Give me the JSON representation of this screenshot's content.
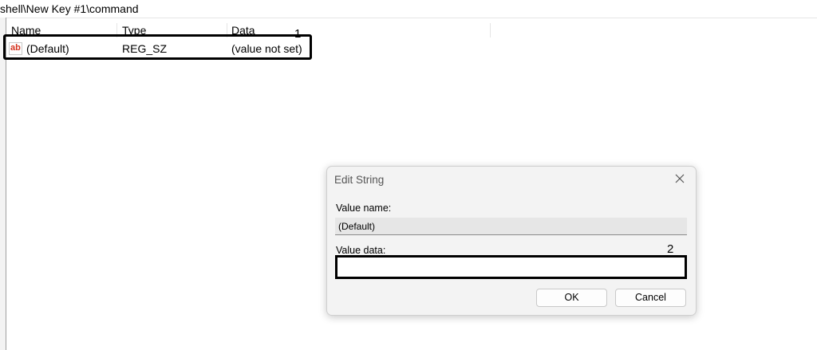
{
  "path_bar": {
    "text": "shell\\New Key #1\\command"
  },
  "list": {
    "columns": [
      "Name",
      "Type",
      "Data"
    ],
    "rows": [
      {
        "icon": "string-value-icon",
        "icon_text": "ab",
        "name": "(Default)",
        "type": "REG_SZ",
        "data": "(value not set)"
      }
    ]
  },
  "annotations": {
    "marker1": "1",
    "marker2": "2",
    "highlight_color": "#000000"
  },
  "dialog": {
    "title": "Edit String",
    "value_name_label": "Value name:",
    "value_name": "(Default)",
    "value_data_label": "Value data:",
    "value_data": "",
    "ok_label": "OK",
    "cancel_label": "Cancel"
  },
  "colors": {
    "icon_red": "#d4331f",
    "dialog_bg": "#f3f3f3"
  }
}
